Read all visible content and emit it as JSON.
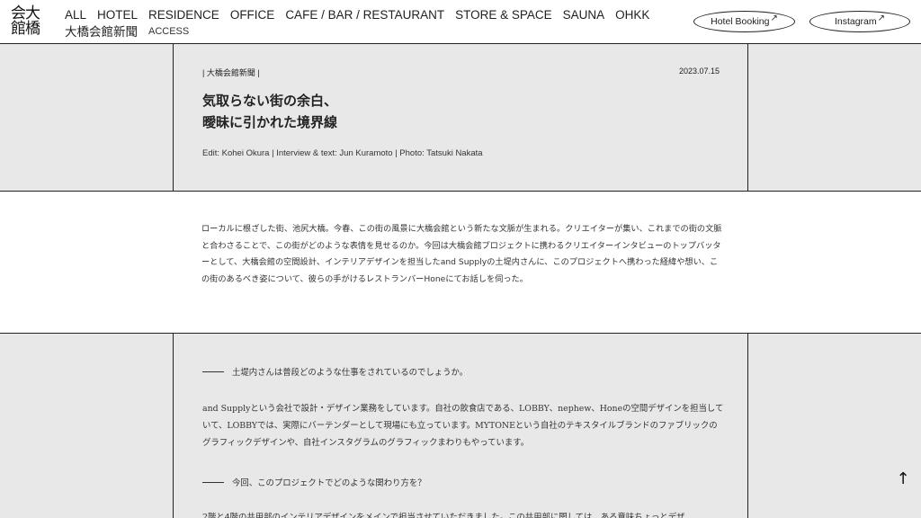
{
  "logo": {
    "line1": "会大",
    "line2": "館橋"
  },
  "nav": {
    "items": [
      "ALL",
      "HOTEL",
      "RESIDENCE",
      "OFFICE",
      "CAFE / BAR / RESTAURANT",
      "STORE & SPACE",
      "SAUNA",
      "OHKK",
      "大橋会館新聞"
    ],
    "access": "ACCESS"
  },
  "external_links": {
    "booking": "Hotel Booking",
    "instagram": "Instagram",
    "arrow": "↗"
  },
  "article": {
    "category": "| 大橋会館新聞 |",
    "date": "2023.07.15",
    "title_line1": "気取らない街の余白、",
    "title_line2": "曖昧に引かれた境界線",
    "credits": "Edit: Kohei Okura | Interview & text: Jun Kuramoto | Photo: Tatsuki Nakata",
    "intro": "ローカルに根ざした街、池尻大橋。今春、この街の風景に大橋会館という新たな文脈が生まれる。クリエイターが集い、これまでの街の文脈と合わさることで、この街がどのような表情を見せるのか。今回は大橋会館プロジェクトに携わるクリエイターインタビューのトップバッターとして、大橋会館の空間設計、インテリアデザインを担当したand Supplyの土堤内さんに、このプロジェクトへ携わった経緯や想い、この街のあるべき姿について、彼らの手がけるレストランバーHoneにてお話しを伺った。",
    "q1": "土堤内さんは普段どのような仕事をされているのでしょうか。",
    "a1": "and Supplyという会社で設計・デザイン業務をしています。自社の飲食店である、LOBBY、nephew、Honeの空間デザインを担当していて、LOBBYでは、実際にバーテンダーとして現場にも立っています。MYTONEという自社のテキスタイルブランドのファブリックのグラフィックデザインや、自社インスタグラムのグラフィックまわりもやっています。",
    "q2": "今回、このプロジェクトでどのような関わり方を？",
    "a2": "2階と4階の共用部のインテリアデザインをメインで担当させていただきました。この共用部に関しては、ある意味ちょっとデザ"
  },
  "back_to_top": "↑"
}
